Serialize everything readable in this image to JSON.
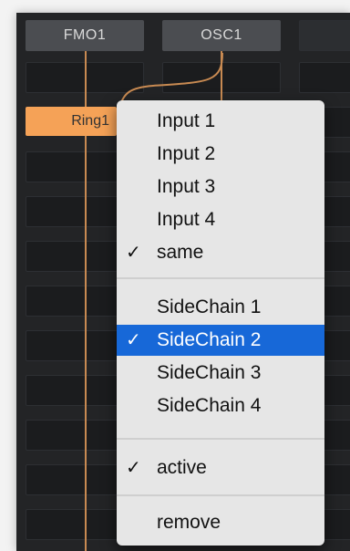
{
  "headers": {
    "fmo": "FMO1",
    "osc": "OSC1"
  },
  "ring": {
    "label": "Ring1"
  },
  "menu": {
    "groups": {
      "inputs": [
        {
          "check": "",
          "label": "Input 1"
        },
        {
          "check": "",
          "label": "Input 2"
        },
        {
          "check": "",
          "label": "Input 3"
        },
        {
          "check": "",
          "label": "Input 4"
        },
        {
          "check": "✓",
          "label": "same"
        }
      ],
      "sidechains": [
        {
          "check": "",
          "label": "SideChain 1"
        },
        {
          "check": "✓",
          "label": "SideChain 2"
        },
        {
          "check": "",
          "label": "SideChain 3"
        },
        {
          "check": "",
          "label": "SideChain 4"
        }
      ],
      "state": [
        {
          "check": "✓",
          "label": "active"
        }
      ],
      "actions": [
        {
          "check": "",
          "label": "remove"
        }
      ]
    },
    "selected": "SideChain 2"
  },
  "colors": {
    "accent": "#1768d8",
    "module": "#f5a257",
    "wire": "#c88a52"
  }
}
